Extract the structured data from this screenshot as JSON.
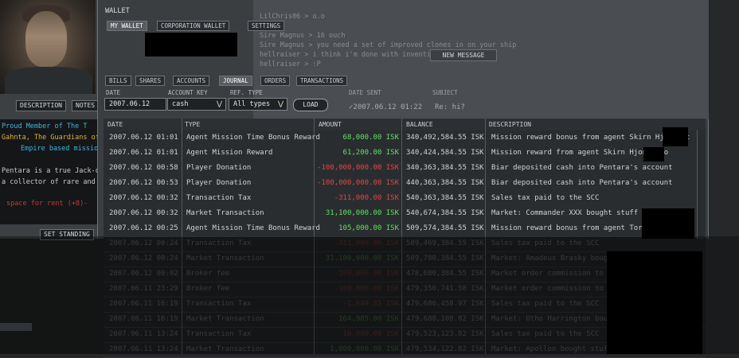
{
  "character": {
    "buttons": [
      "DESCRIPTION",
      "NOTES"
    ],
    "bio_lines": [
      {
        "text": "Proud Member of The T",
        "color": "#3fb6e0"
      },
      {
        "text": "Gahnta, The Guardians of P",
        "color": "#e0b23f"
      },
      {
        "text": "Empire based mission",
        "color": "#3fb6e0"
      },
      {
        "text": "Pentara is a true Jack-of-a",
        "color": "#c8cdd1"
      },
      {
        "text": "a collector of rare and inter",
        "color": "#c8cdd1"
      },
      {
        "text": "space for rent (+8)-",
        "color": "#c83a3a"
      }
    ],
    "set_standing_label": "SET STANDING"
  },
  "chat": {
    "lines": [
      "LilChris06 > o.o",
      "Sire Magnus > 16   ouch",
      "Sire Magnus > you need a set of improved clones in on your ship",
      "hellraiser > i think i'm done with invention to",
      "hellraiser > :P"
    ],
    "new_message_label": "NEW MESSAGE"
  },
  "wallet": {
    "title": "WALLET",
    "top_tabs": [
      {
        "label": "MY WALLET",
        "active": true
      },
      {
        "label": "CORPORATION WALLET",
        "active": false
      },
      {
        "label": "SETTINGS",
        "active": false
      }
    ],
    "sub_tabs": [
      {
        "label": "BILLS",
        "active": false
      },
      {
        "label": "SHARES",
        "active": false
      },
      {
        "label": "ACCOUNTS",
        "active": false
      },
      {
        "label": "JOURNAL",
        "active": true
      },
      {
        "label": "ORDERS",
        "active": false
      },
      {
        "label": "TRANSACTIONS",
        "active": false
      }
    ],
    "filters": {
      "date_label": "DATE",
      "date_value": "2007.06.12",
      "account_label": "ACCOUNT KEY",
      "account_value": "cash",
      "ref_label": "REF. TYPE",
      "ref_value": "All types",
      "load_label": "LOAD"
    },
    "mail_header": {
      "date_sent_label": "DATE SENT",
      "subject_label": "SUBJECT",
      "date_sent_value": "2007.06.12 01:22",
      "subject_value": "Re: hi?"
    },
    "columns": [
      "DATE",
      "TYPE",
      "AMOUNT",
      "BALANCE",
      "DESCRIPTION"
    ],
    "rows": [
      {
        "date": "2007.06.12 01:01",
        "type": "Agent Mission Time Bonus Reward",
        "amount": "68,000.00 ISK",
        "sign": "pos",
        "balance": "340,492,584.55 ISK",
        "desc": "Mission reward bonus from agent Skirn Hjonur t"
      },
      {
        "date": "2007.06.12 01:01",
        "type": "Agent Mission Reward",
        "amount": "61,200.00 ISK",
        "sign": "pos",
        "balance": "340,424,584.55 ISK",
        "desc": "Mission reward from agent Skirn Hjonur to"
      },
      {
        "date": "2007.06.12 00:58",
        "type": "Player Donation",
        "amount": "-100,000,000.00 ISK",
        "sign": "neg",
        "balance": "340,363,384.55 ISK",
        "desc": "Biar deposited cash into Pentara's account"
      },
      {
        "date": "2007.06.12 00:53",
        "type": "Player Donation",
        "amount": "-100,000,000.00 ISK",
        "sign": "neg",
        "balance": "440,363,384.55 ISK",
        "desc": "Biar deposited cash into Pentara's account"
      },
      {
        "date": "2007.06.12 00:32",
        "type": "Transaction Tax",
        "amount": "-311,000.00 ISK",
        "sign": "neg",
        "balance": "540,363,384.55 ISK",
        "desc": "Sales tax paid to the SCC"
      },
      {
        "date": "2007.06.12 00:32",
        "type": "Market Transaction",
        "amount": "31,100,000.00 ISK",
        "sign": "pos",
        "balance": "540,674,384.55 ISK",
        "desc": "Market: Commander XXX bought stuff from"
      },
      {
        "date": "2007.06.12 00:25",
        "type": "Agent Mission Time Bonus Reward",
        "amount": "105,000.00 ISK",
        "sign": "pos",
        "balance": "509,574,384.55 ISK",
        "desc": "Mission reward bonus from agent Torlaber"
      },
      {
        "date": "2007.06.12 00:24",
        "type": "Transaction Tax",
        "amount": "-311,000.00 ISK",
        "sign": "neg",
        "balance": "509,469,384.55 ISK",
        "desc": "Sales tax paid to the SCC"
      },
      {
        "date": "2007.06.12 00:24",
        "type": "Market Transaction",
        "amount": "31,100,000.00 ISK",
        "sign": "pos",
        "balance": "509,780,384.55 ISK",
        "desc": "Market: Amadeus Brasky bought"
      },
      {
        "date": "2007.06.12 00:02",
        "type": "Broker fee",
        "amount": "-100,000.00 ISK",
        "sign": "neg",
        "balance": "478,680,384.55 ISK",
        "desc": "Market order commission to brok"
      },
      {
        "date": "2007.06.11 23:29",
        "type": "Broker fee",
        "amount": "-100,000.00 ISK",
        "sign": "neg",
        "balance": "479,350,741.58 ISK",
        "desc": "Market order commission to brok"
      },
      {
        "date": "2007.06.11 16:19",
        "type": "Transaction Tax",
        "amount": "-1,649.85 ISK",
        "sign": "neg",
        "balance": "479,686,458.97 ISK",
        "desc": "Sales tax paid to the SCC"
      },
      {
        "date": "2007.06.11 16:19",
        "type": "Market Transaction",
        "amount": "164,985.00 ISK",
        "sign": "pos",
        "balance": "479,688,108.82 ISK",
        "desc": "Market: Otho Harrington bought s"
      },
      {
        "date": "2007.06.11 13:24",
        "type": "Transaction Tax",
        "amount": "-10,000.00 ISK",
        "sign": "neg",
        "balance": "479,523,123.82 ISK",
        "desc": "Sales tax paid to the SCC"
      },
      {
        "date": "2007.06.11 13:24",
        "type": "Market Transaction",
        "amount": "1,000,000.00 ISK",
        "sign": "pos",
        "balance": "479,534,122.82 ISK",
        "desc": "Market: Apollon bought stuff from"
      }
    ],
    "colors": {
      "positive": "#5fe05f",
      "negative": "#e04545"
    }
  }
}
